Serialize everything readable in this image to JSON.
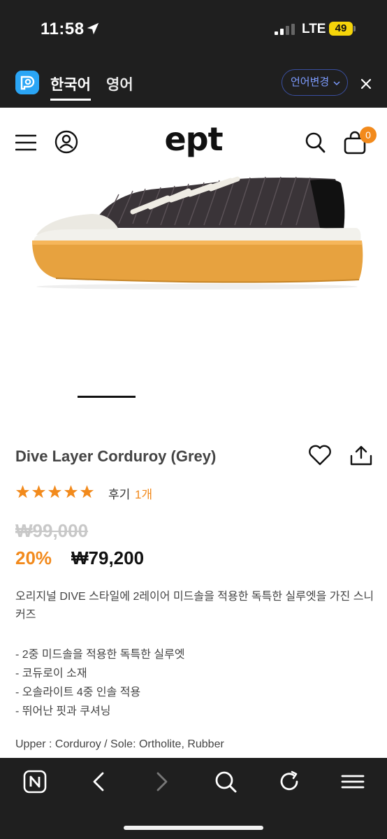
{
  "status_bar": {
    "time": "11:58",
    "network": "LTE",
    "battery": "49",
    "icons": [
      "location-arrow-icon",
      "signal-icon",
      "battery-icon"
    ]
  },
  "translate_bar": {
    "lang_korean": "한국어",
    "lang_english": "영어",
    "change_language": "언어변경",
    "icons": [
      "papago-icon",
      "chevron-down-icon",
      "close-icon"
    ]
  },
  "header": {
    "logo": "ept",
    "cart_count": "0",
    "icons": [
      "menu-icon",
      "user-icon",
      "search-icon",
      "cart-icon"
    ]
  },
  "product": {
    "title": "Dive Layer Corduroy (Grey)",
    "rating": 5,
    "rating_max": 5,
    "review_label": "후기",
    "review_count": "1개",
    "original_price": "₩99,000",
    "discount": "20%",
    "price": "₩79,200",
    "description_line1": "오리지널 DIVE 스타일에 2레이어 미드솔을 적용한 독특한 실루엣을 가진 스니",
    "description_line2": "커즈",
    "bullets": [
      "- 2중 미드솔을 적용한 독특한 실루엣",
      "- 코듀로이 소재",
      "- 오솔라이트 4중 인솔 적용",
      "- 뛰어난 핏과 쿠셔닝"
    ],
    "spec": "Upper : Corduroy / Sole: Ortholite, Rubber"
  },
  "colors": {
    "accent": "#f28a1c",
    "dark_bar": "#1f1f1f",
    "link_blue": "#7d9cff"
  },
  "bottom_nav": {
    "icons": [
      "naver-icon",
      "back-icon",
      "forward-icon",
      "search-icon",
      "refresh-icon",
      "menu-icon"
    ]
  }
}
